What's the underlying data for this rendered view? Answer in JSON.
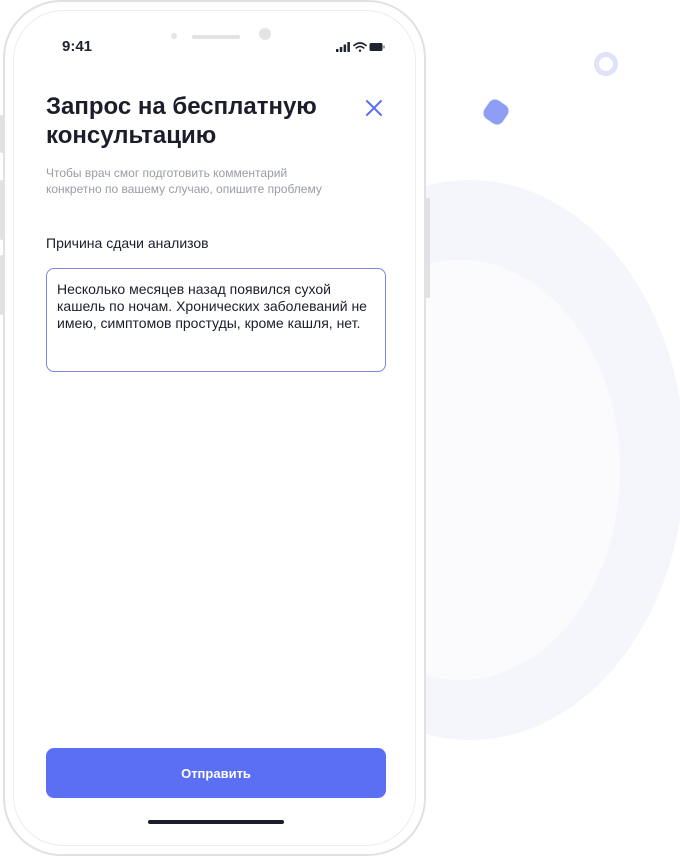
{
  "status_bar": {
    "time": "9:41"
  },
  "form": {
    "title": "Запрос на бесплатную консультацию",
    "subtitle": "Чтобы врач смог подготовить комментарий конкретно по вашему случаю, опишите проблему",
    "field_label": "Причина сдачи анализов",
    "field_value": "Несколько месяцев назад появился сухой кашель по ночам. Хронических заболеваний не имею, симптомов простуды, кроме кашля, нет.",
    "submit_label": "Отправить"
  },
  "icons": {
    "close": "close-icon",
    "signal": "signal-icon",
    "wifi": "wifi-icon",
    "battery": "battery-icon"
  },
  "colors": {
    "accent": "#5b6ff5",
    "field_border": "#7d87e8",
    "title": "#1b1d2b",
    "subtitle": "#9a9ca6"
  }
}
